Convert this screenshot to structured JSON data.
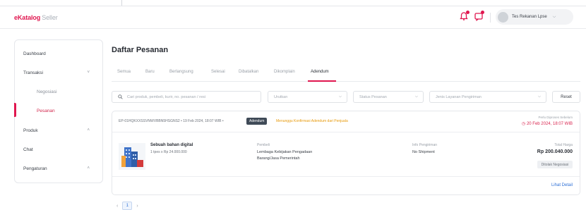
{
  "app": {
    "logo_brand": "eKatalog",
    "logo_sub": "Seller"
  },
  "header": {
    "user_name": "Tes Rekanan Lpse",
    "icons": [
      "bell-icon",
      "chat-icon"
    ]
  },
  "sidebar": {
    "items": [
      {
        "label": "Dashboard"
      },
      {
        "label": "Transaksi",
        "caret": "˅"
      },
      {
        "label": "Negosiasi"
      },
      {
        "label": "Pesanan"
      },
      {
        "label": "Produk",
        "caret": "˄"
      },
      {
        "label": "Chat"
      },
      {
        "label": "Pengaturan",
        "caret": "˄"
      }
    ]
  },
  "main": {
    "title": "Daftar Pesanan",
    "tabs": [
      {
        "label": "Semua"
      },
      {
        "label": "Baru"
      },
      {
        "label": "Berlangsung"
      },
      {
        "label": "Selesai"
      },
      {
        "label": "Dibatalkan"
      },
      {
        "label": "Dikomplain"
      },
      {
        "label": "Adendum"
      }
    ],
    "active_tab": "Adendum",
    "filters": {
      "search_placeholder": "Cari produk, pembeli, kurir, no. pesanan / resi",
      "sort": "Urutkan",
      "status": "Status Pesanan",
      "shipping": "Jenis Layanan Pengiriman",
      "reset": "Reset"
    },
    "order": {
      "id_line": "EP-01HQKXXSSVNWVBBN5HSGNS2 • 19 Feb 2024, 18:07 WIB •",
      "badge": "Adendum",
      "warning": "Menunggu Konfirmasi Adendum dari Penjuala",
      "deadline_label": "Perlu Diproses Sebelum",
      "deadline": "20 Feb 2024, 18:07 WIB",
      "product_name": "Sebuah bahan digital",
      "product_qty": "1 tpes x Rp 24.000.000",
      "buyer_label": "Pembeli",
      "buyer_value_1": "Lembaga Kebijakan Pengadaan",
      "buyer_value_2": "Barang/Jasa Pemerintah",
      "shipping_label": "Info Pengiriman",
      "shipping_value": "No Shipment",
      "total_label": "Total Harga",
      "total_value": "Rp 200.040.000",
      "review_button": "Ditolak Negosiasi",
      "detail_link": "Lihat Detail"
    },
    "pagination": {
      "prev": "‹",
      "page": "1",
      "next": "›"
    }
  },
  "colors": {
    "brand": "#e0164f",
    "link": "#2d6fd6",
    "warning": "#e79a0c",
    "badge": "#3f4a57"
  }
}
